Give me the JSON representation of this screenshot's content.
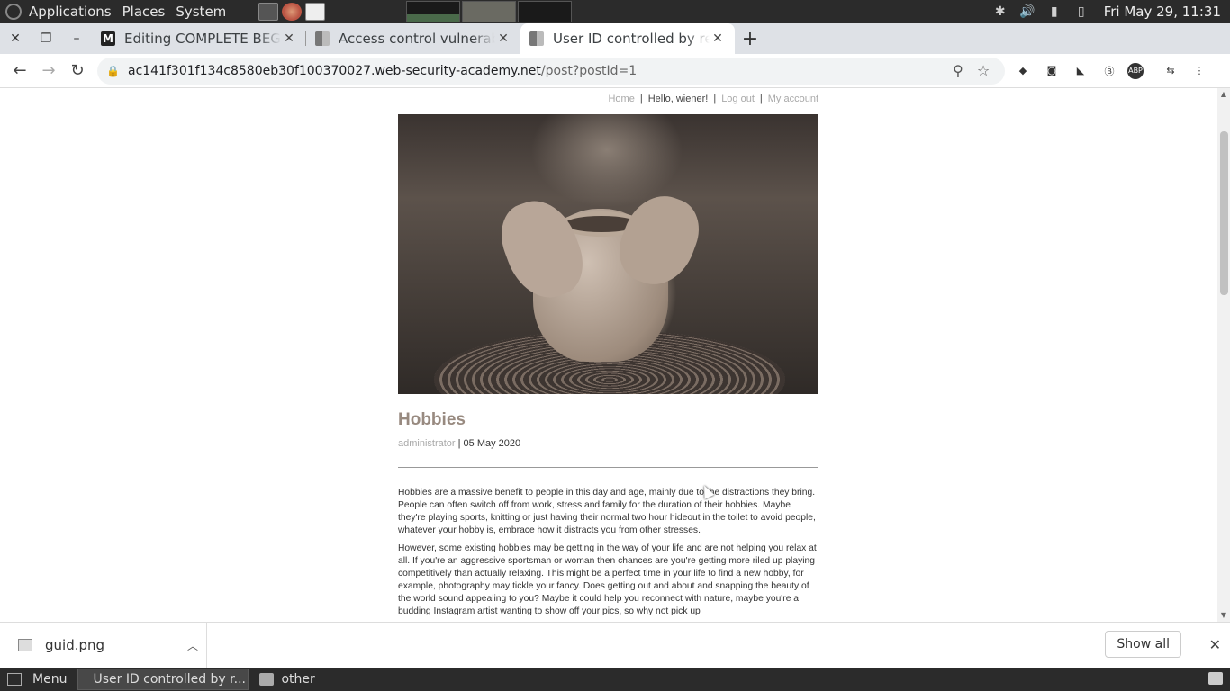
{
  "top_panel": {
    "applications": "Applications",
    "places": "Places",
    "system": "System",
    "clock": "Fri May 29, 11:31"
  },
  "tabs": [
    {
      "title": "Editing COMPLETE BEGINNER'S GUIDE",
      "favicon": "medium-icon"
    },
    {
      "title": "Access control vulnerabilities",
      "favicon": "portswigger-icon"
    },
    {
      "title": "User ID controlled by request parameter",
      "favicon": "portswigger-icon"
    }
  ],
  "address_bar": {
    "host": "ac141f301f134c8580eb30f100370027.web-security-academy.net",
    "path": "/post?postId=1"
  },
  "site_nav": {
    "home": "Home",
    "sep": "|",
    "greeting": "Hello, wiener!",
    "logout": "Log out",
    "my_account": "My account"
  },
  "post": {
    "title": "Hobbies",
    "author": "administrator",
    "date": "| 05 May 2020",
    "paragraphs": [
      "Hobbies are a massive benefit to people in this day and age, mainly due to the distractions they bring. People can often switch off from work, stress and family for the duration of their hobbies. Maybe they're playing sports, knitting or just having their normal two hour hideout in the toilet to avoid people, whatever your hobby is, embrace how it distracts you from other stresses.",
      "However, some existing hobbies may be getting in the way of your life and are not helping you relax at all. If you're an aggressive sportsman or woman then chances are you're getting more riled up playing competitively than actually relaxing. This might be a perfect time in your life to find a new hobby, for example, photography may tickle your fancy. Does getting out and about and snapping the beauty of the world sound appealing to you? Maybe it could help you reconnect with nature, maybe you're a budding Instagram artist wanting to show off your pics, so why not pick up"
    ]
  },
  "downloads": {
    "file": "guid.png",
    "show_all": "Show all"
  },
  "taskbar": {
    "menu": "Menu",
    "window1": "User ID controlled by r...",
    "window2": "other"
  }
}
